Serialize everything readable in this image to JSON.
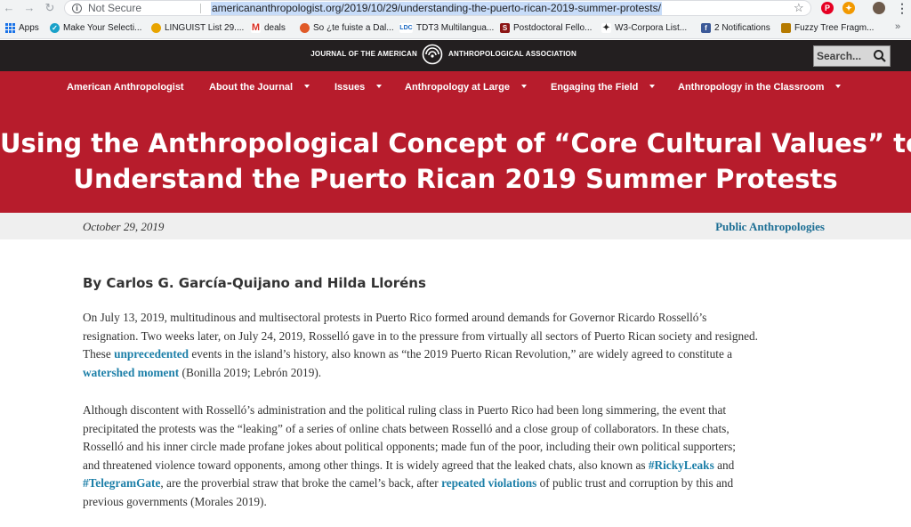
{
  "browser": {
    "not_secure": "Not Secure",
    "url": "americananthropologist.org/2019/10/29/understanding-the-puerto-rican-2019-summer-protests/",
    "bookmarks": [
      {
        "label": "Apps",
        "icon": "apps-grid-icon",
        "color": "#1a73e8"
      },
      {
        "label": "Make Your Selecti...",
        "icon": "bookmark-favicon",
        "color": "#19a1c9"
      },
      {
        "label": "LINGUIST List 29....",
        "icon": "bookmark-favicon",
        "color": "#e8a400"
      },
      {
        "label": "deals",
        "icon": "gmail-icon",
        "color": "#d93025"
      },
      {
        "label": "So ¿te fuiste a Dal...",
        "icon": "bookmark-favicon",
        "color": "#e05a28"
      },
      {
        "label": "TDT3 Multilangua...",
        "icon": "ldc-icon",
        "color": "#1565c0"
      },
      {
        "label": "Postdoctoral Fello...",
        "icon": "stanford-icon",
        "color": "#8c1515"
      },
      {
        "label": "W3-Corpora List...",
        "icon": "bookmark-favicon",
        "color": "#222222"
      },
      {
        "label": "2 Notifications",
        "icon": "facebook-icon",
        "color": "#3b5998"
      },
      {
        "label": "Fuzzy Tree Fragm...",
        "icon": "bookmark-favicon",
        "color": "#b57a00"
      }
    ]
  },
  "site": {
    "journal_left": "JOURNAL OF THE AMERICAN",
    "journal_right": "ANTHROPOLOGICAL ASSOCIATION",
    "search_placeholder": "Search...",
    "nav": [
      {
        "label": "American Anthropologist",
        "dropdown": false
      },
      {
        "label": "About the Journal",
        "dropdown": true
      },
      {
        "label": "Issues",
        "dropdown": true
      },
      {
        "label": "Anthropology at Large",
        "dropdown": true
      },
      {
        "label": "Engaging the Field",
        "dropdown": true
      },
      {
        "label": "Anthropology in the Classroom",
        "dropdown": true
      }
    ],
    "brand_red": "#b71c2c",
    "link_blue": "#1c7fa8"
  },
  "article": {
    "title_line1": "Using the Anthropological Concept of “Core Cultural Values” to",
    "title_line2": "Understand the Puerto Rican 2019 Summer Protests",
    "date": "October 29, 2019",
    "category": "Public Anthropologies",
    "byline": "By Carlos G. García-Quijano and Hilda Lloréns",
    "p1": {
      "l1": "On July 13, 2019, multitudinous and multisectoral protests in Puerto Rico formed around demands for Governor Ricardo Rosselló’s",
      "l2": "resignation. Two weeks later, on July 24, 2019, Rosselló gave in to the pressure from virtually all sectors of Puerto Rican society and resigned.",
      "l3a": "These ",
      "l3link": "unprecedented",
      "l3b": " events in the island’s history, also known as “the 2019 Puerto Rican Revolution,” are widely agreed to constitute a",
      "l4link": "watershed moment",
      "l4b": " (Bonilla 2019; Lebrón 2019)."
    },
    "p2": {
      "l1": "Although discontent with Rosselló’s administration and the political ruling class in Puerto Rico had been long simmering, the event that",
      "l2": "precipitated the protests was the “leaking” of a series of online chats between Rosselló and a close group of collaborators. In these chats,",
      "l3": "Rosselló and his inner circle made profane jokes about political opponents; made fun of the poor, including their own political supporters;",
      "l4a": "and threatened violence toward opponents, among other things. It is widely agreed that the leaked chats, also known as ",
      "l4link": "#RickyLeaks",
      "l4b": " and",
      "l5link1": "#TelegramGate",
      "l5a": ", are the proverbial straw that broke the camel’s back, after ",
      "l5link2": "repeated violations",
      "l5b": " of public trust and corruption by this and",
      "l6": "previous governments (Morales 2019)."
    }
  }
}
